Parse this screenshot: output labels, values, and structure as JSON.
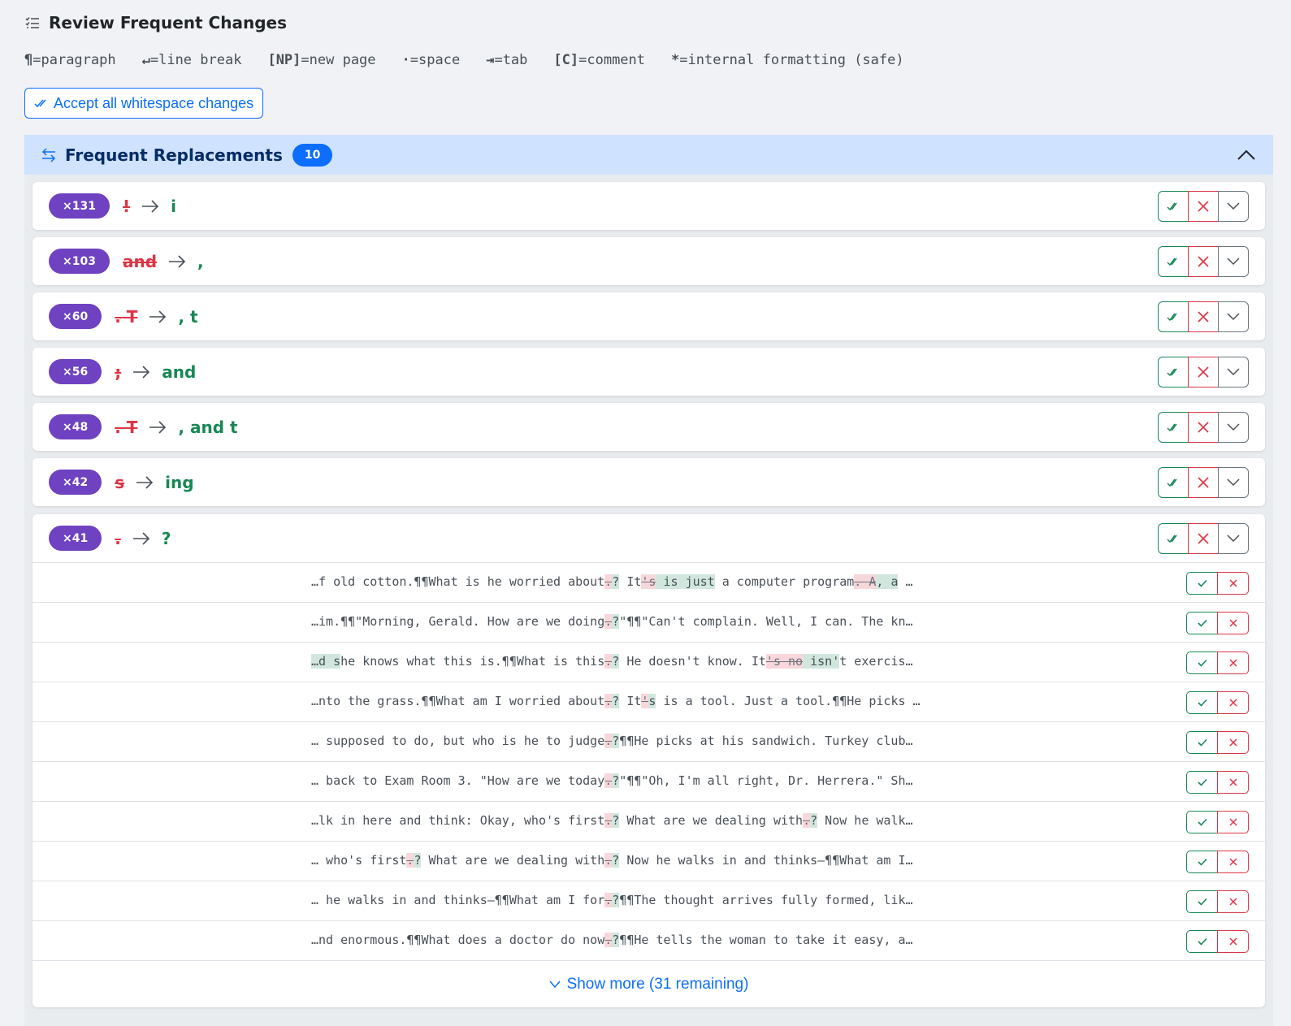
{
  "page": {
    "title": "Review Frequent Changes"
  },
  "legend": [
    {
      "sym": "¶",
      "text": "=paragraph"
    },
    {
      "sym": "↵",
      "text": "=line break"
    },
    {
      "sym": "[NP]",
      "text": "=new page"
    },
    {
      "sym": "·",
      "text": "=space"
    },
    {
      "sym": "⇥",
      "text": "=tab"
    },
    {
      "sym": "[C]",
      "text": "=comment"
    },
    {
      "sym": "*",
      "text": "=internal formatting (safe)"
    }
  ],
  "accept_all_label": "Accept all whitespace changes",
  "panel": {
    "title": "Frequent Replacements",
    "count": "10"
  },
  "replacements": [
    {
      "count": "×131",
      "from": "!",
      "to": "i"
    },
    {
      "count": "×103",
      "from": "and",
      "to": ","
    },
    {
      "count": "×60",
      "from": ". T",
      "to": ", t"
    },
    {
      "count": "×56",
      "from": ";",
      "to": "and"
    },
    {
      "count": "×48",
      "from": ". T",
      "to": ", and t"
    },
    {
      "count": "×42",
      "from": "s",
      "to": "ing"
    },
    {
      "count": "×41",
      "from": ".",
      "to": "?"
    }
  ],
  "contexts": [
    [
      [
        "…f old cotton.¶¶What is he worried about",
        ""
      ],
      [
        ".",
        "del"
      ],
      [
        "?",
        "ins"
      ],
      [
        " It",
        ""
      ],
      [
        "'s",
        "del"
      ],
      [
        " is just",
        "ins"
      ],
      [
        " a computer program",
        ""
      ],
      [
        ". A",
        "del"
      ],
      [
        ", a",
        "ins"
      ],
      [
        " …",
        ""
      ]
    ],
    [
      [
        "…im.¶¶\"Morning, Gerald. How are we doing",
        ""
      ],
      [
        ".",
        "del"
      ],
      [
        "?",
        "ins"
      ],
      [
        "\"¶¶\"Can't complain. Well, I can. The kn…",
        ""
      ]
    ],
    [
      [
        "…d s",
        "ins"
      ],
      [
        "he knows what this is.¶¶What is this",
        ""
      ],
      [
        ".",
        "del"
      ],
      [
        "?",
        "ins"
      ],
      [
        " He doesn't know. It",
        ""
      ],
      [
        "'s no",
        "del"
      ],
      [
        " isn'",
        "ins"
      ],
      [
        "t exercis…",
        ""
      ]
    ],
    [
      [
        "…nto the grass.¶¶What am I worried about",
        ""
      ],
      [
        ".",
        "del"
      ],
      [
        "?",
        "ins"
      ],
      [
        " It",
        ""
      ],
      [
        "'",
        "del"
      ],
      [
        "s",
        "ins"
      ],
      [
        " is a tool. Just a tool.¶¶He picks …",
        ""
      ]
    ],
    [
      [
        "… supposed to do, but who is he to judge",
        ""
      ],
      [
        ".",
        "del"
      ],
      [
        "?",
        "ins"
      ],
      [
        "¶¶He picks at his sandwich. Turkey club…",
        ""
      ]
    ],
    [
      [
        "… back to Exam Room 3. \"How are we today",
        ""
      ],
      [
        ".",
        "del"
      ],
      [
        "?",
        "ins"
      ],
      [
        "\"¶¶\"Oh, I'm all right, Dr. Herrera.\" Sh…",
        ""
      ]
    ],
    [
      [
        "…lk in here and think: Okay, who's first",
        ""
      ],
      [
        ".",
        "del"
      ],
      [
        "?",
        "ins"
      ],
      [
        " What are we dealing with",
        ""
      ],
      [
        ".",
        "del"
      ],
      [
        "?",
        "ins"
      ],
      [
        " Now he walk…",
        ""
      ]
    ],
    [
      [
        "… who's first",
        ""
      ],
      [
        ".",
        "del"
      ],
      [
        "?",
        "ins"
      ],
      [
        " What are we dealing with",
        ""
      ],
      [
        ".",
        "del"
      ],
      [
        "?",
        "ins"
      ],
      [
        " Now he walks in and thinks—¶¶What am I…",
        ""
      ]
    ],
    [
      [
        "… he walks in and thinks—¶¶What am I for",
        ""
      ],
      [
        ".",
        "del"
      ],
      [
        "?",
        "ins"
      ],
      [
        "¶¶The thought arrives fully formed, lik…",
        ""
      ]
    ],
    [
      [
        "…nd enormous.¶¶What does a doctor do now",
        ""
      ],
      [
        ".",
        "del"
      ],
      [
        "?",
        "ins"
      ],
      [
        "¶¶He tells the woman to take it easy, a…",
        ""
      ]
    ]
  ],
  "show_more_label": "Show more (31 remaining)",
  "colors": {
    "accent": "#0d6efd",
    "badge_purple": "#6f42c1",
    "accept_green": "#198754",
    "reject_red": "#dc3545"
  }
}
